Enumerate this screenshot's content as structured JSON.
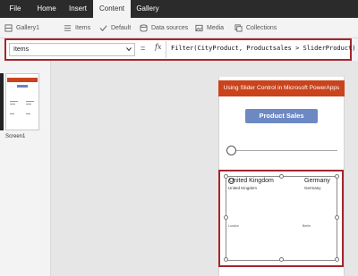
{
  "menu": {
    "tabs": [
      {
        "label": "File",
        "active": false
      },
      {
        "label": "Home",
        "active": false
      },
      {
        "label": "Insert",
        "active": false
      },
      {
        "label": "Content",
        "active": true
      },
      {
        "label": "Gallery",
        "active": false
      }
    ]
  },
  "ribbon": {
    "items": [
      {
        "label": "Gallery1",
        "icon": "gallery-icon"
      },
      {
        "label": "Items",
        "icon": "items-list-icon"
      },
      {
        "label": "Default",
        "icon": "checkmark-icon"
      },
      {
        "label": "Data sources",
        "icon": "database-icon"
      },
      {
        "label": "Media",
        "icon": "image-icon"
      },
      {
        "label": "Collections",
        "icon": "collections-icon"
      }
    ]
  },
  "formula_bar": {
    "property": "Items",
    "equals": "=",
    "fx": "fx",
    "formula": "Filter(CityProduct, Productsales > SliderProduct)"
  },
  "screens": {
    "items": [
      {
        "label": "Screen1"
      }
    ]
  },
  "app": {
    "header_title": "Using Slider Control in Microsoft PowerApps",
    "button_label": "Product Sales",
    "slider_value": 0,
    "gallery": {
      "items": [
        {
          "title": "United Kingdom",
          "subtitle": "United Kingdom",
          "detail": "London"
        },
        {
          "title": "Germany",
          "subtitle": "Germany",
          "detail": "Berlin"
        }
      ]
    }
  },
  "colors": {
    "menubar": "#2b2b2b",
    "header": "#c9431c",
    "button": "#6c89c4",
    "highlight_border": "#a4262c"
  }
}
